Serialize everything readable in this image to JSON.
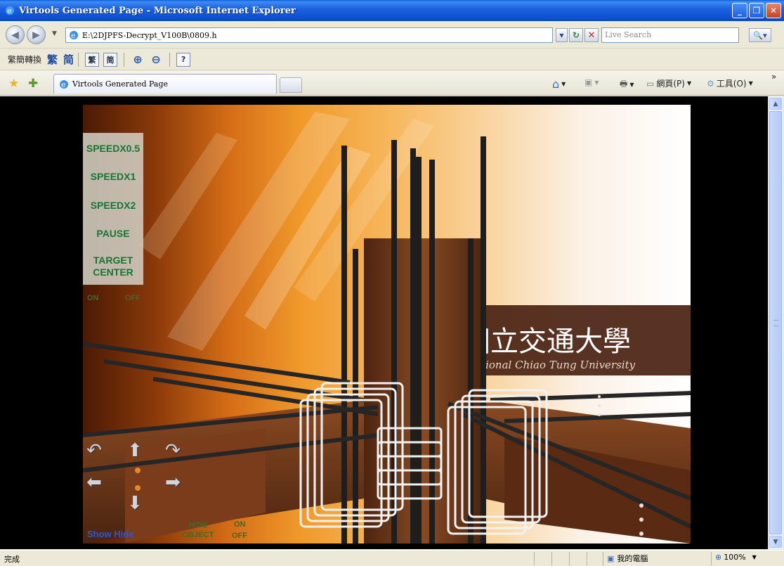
{
  "window": {
    "title": "Virtools Generated Page - Microsoft Internet Explorer"
  },
  "address_bar": {
    "url": "E:\\2DJPFS-Decrypt_V100B\\0809.h",
    "search_placeholder": "Live Search"
  },
  "convert_toolbar": {
    "label": "繁簡轉換",
    "traditional": "繁",
    "simplified": "简",
    "help_icon": "?"
  },
  "tabs": [
    {
      "label": "Virtools Generated Page"
    }
  ],
  "commands": {
    "page": "網頁(P)",
    "tools": "工具(O)"
  },
  "scene": {
    "banner_text": "國立交通大學",
    "banner_subtext": "National Chiao Tung University",
    "controls": [
      {
        "label": "SPEEDX0.5"
      },
      {
        "label": "SPEEDX1"
      },
      {
        "label": "SPEEDX2"
      },
      {
        "label": "PAUSE"
      },
      {
        "label": "TARGET CENTER"
      }
    ],
    "toggle_on": "ON",
    "toggle_off": "OFF",
    "show_hide": "Show  Hide",
    "hide_object": "HIDE OBJECT",
    "hide_on": "ON",
    "hide_off": "OFF"
  },
  "status": {
    "text": "完成",
    "zone": "我的電腦",
    "zoom": "100%"
  },
  "colors": {
    "title_bar": "#1d63e0",
    "control_text": "#1f6e34",
    "show_hide_text": "#3555c5"
  }
}
